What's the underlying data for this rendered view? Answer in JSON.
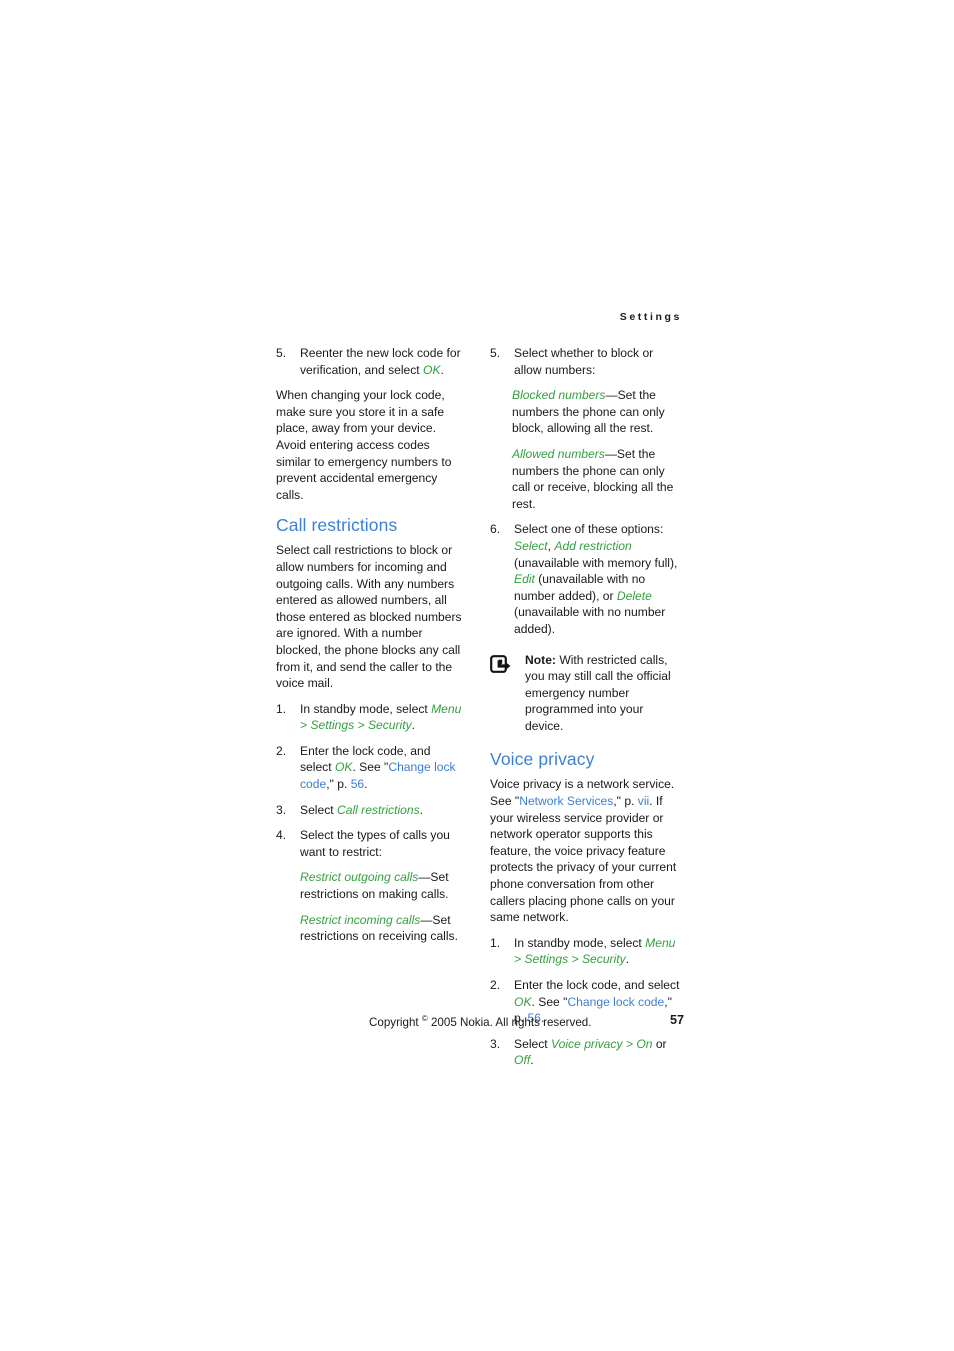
{
  "document": {
    "running_header": "Settings",
    "footer": {
      "copyright_prefix": "Copyright ",
      "copyright_symbol": "©",
      "copyright_rest": " 2005 Nokia. All rights reserved.",
      "page_number": "57"
    },
    "colors": {
      "heading_blue": "#3c7fd8",
      "link_blue": "#3d7fd6",
      "ui_green": "#34a041",
      "body_text": "#1a1a1a"
    }
  },
  "left_column": {
    "step5": {
      "number": "5.",
      "text_before": "Reenter the new lock code for verification, and select ",
      "ui_ok": "OK",
      "text_after": "."
    },
    "paragraph_lock_code": "When changing your lock code, make sure you store it in a safe place, away from your device. Avoid entering access codes similar to emergency numbers to prevent accidental emergency calls.",
    "heading_call_restrictions": "Call restrictions",
    "paragraph_call_restrictions": "Select call restrictions to block or allow numbers for incoming and outgoing calls. With any numbers entered as allowed numbers, all those entered as blocked numbers are ignored. With a number blocked, the phone blocks any call from it, and send the caller to the voice mail.",
    "steps": [
      {
        "number": "1.",
        "seg1": "In standby mode, select ",
        "ui1": "Menu",
        "seg2": " > ",
        "ui2": "Settings",
        "seg3": " > ",
        "ui3": "Security",
        "seg4": "."
      },
      {
        "number": "2.",
        "seg1": "Enter the lock code, and select ",
        "ui1": "OK",
        "seg2": ". See \"",
        "link1": "Change lock code",
        "seg3": ",\" p. ",
        "link2": "56",
        "seg4": "."
      },
      {
        "number": "3.",
        "seg1": "Select ",
        "ui1": "Call restrictions",
        "seg2": "."
      },
      {
        "number": "4.",
        "seg1": "Select the types of calls you want to restrict:"
      }
    ],
    "definitions": [
      {
        "term": "Restrict outgoing calls",
        "dash": "—",
        "definition": "Set restrictions on making calls."
      },
      {
        "term": "Restrict incoming calls",
        "dash": "—",
        "definition": "Set restrictions on receiving calls."
      }
    ]
  },
  "right_column": {
    "step5": {
      "number": "5.",
      "text": "Select whether to block or allow numbers:"
    },
    "definitions": [
      {
        "term": "Blocked numbers",
        "dash": "—",
        "definition": "Set the numbers the phone can only block, allowing all the rest."
      },
      {
        "term": "Allowed numbers",
        "dash": "—",
        "definition": "Set the numbers the phone can only call or receive, blocking all the rest."
      }
    ],
    "step6": {
      "number": "6.",
      "seg1": "Select one of these options: ",
      "ui1": "Select",
      "seg2": ", ",
      "ui2": "Add restriction",
      "seg3": " (unavailable with memory full), ",
      "ui3": "Edit",
      "seg4": " (unavailable with no number added), or ",
      "ui4": "Delete",
      "seg5": " (unavailable with no number added)."
    },
    "note": {
      "icon": "note-pointer-icon",
      "label": "Note:",
      "text": " With restricted calls, you may still call the official emergency number programmed into your device."
    },
    "heading_voice_privacy": "Voice privacy",
    "paragraph_voice_privacy": {
      "seg1": "Voice privacy is a network service. See \"",
      "link1": "Network Services",
      "seg2": ",\" p. ",
      "link2": "vii",
      "seg3": ". If your wireless service provider or network operator supports this feature, the voice privacy feature protects the privacy of your current phone conversation from other callers placing phone calls on your same network."
    },
    "steps": [
      {
        "number": "1.",
        "seg1": "In standby mode, select ",
        "ui1": "Menu",
        "seg2": " > ",
        "ui2": "Settings",
        "seg3": " > ",
        "ui3": "Security",
        "seg4": "."
      },
      {
        "number": "2.",
        "seg1": "Enter the lock code, and select ",
        "ui1": "OK",
        "seg2": ". See \"",
        "link1": "Change lock code",
        "seg3": ",\" p. ",
        "link2": "56",
        "seg4": "."
      },
      {
        "number": "3.",
        "seg1": "Select ",
        "ui1": "Voice privacy",
        "seg2": " > ",
        "ui2": "On",
        "seg3": " or ",
        "ui3": "Off",
        "seg4": "."
      }
    ]
  }
}
